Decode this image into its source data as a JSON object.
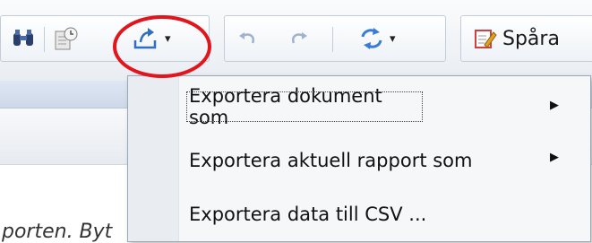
{
  "toolbar": {
    "track_label": "Spåra",
    "export_caret": "▾",
    "refresh_caret": "▾"
  },
  "export_menu": {
    "items": [
      {
        "label": "Exportera dokument som",
        "has_submenu": true
      },
      {
        "label": "Exportera aktuell rapport som",
        "has_submenu": true
      },
      {
        "label": "Exportera data till CSV ...",
        "has_submenu": false
      }
    ],
    "submenu_arrow": "▶"
  },
  "background": {
    "text": "porten. Byt"
  },
  "colors": {
    "highlight_ring": "#e2141c",
    "icon_blue": "#2f6fbf"
  }
}
